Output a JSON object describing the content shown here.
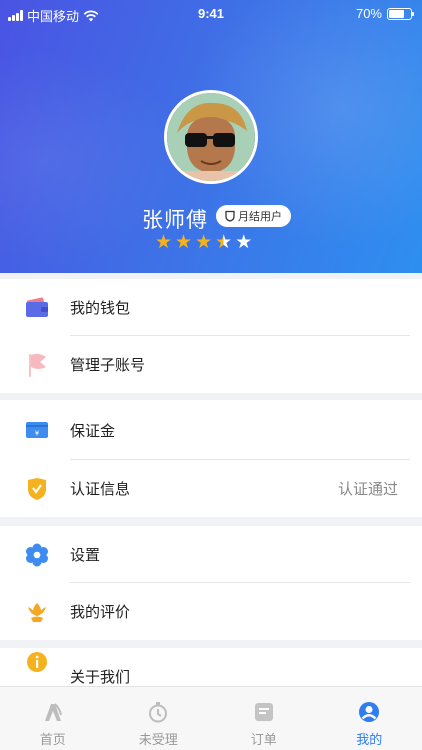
{
  "status_bar": {
    "carrier": "中国移动",
    "time": "9:41",
    "battery": "70%",
    "battery_level": 0.7
  },
  "profile": {
    "name": "张师傅",
    "badge": "月结用户",
    "rating": 3.5,
    "rating_max": 5
  },
  "menu": {
    "wallet": "我的钱包",
    "sub_accounts": "管理子账号",
    "deposit": "保证金",
    "verification": "认证信息",
    "verification_status": "认证通过",
    "settings": "设置",
    "reviews": "我的评价",
    "about": "关于我们"
  },
  "tabs": [
    {
      "label": "首页"
    },
    {
      "label": "未受理"
    },
    {
      "label": "订单"
    },
    {
      "label": "我的"
    }
  ],
  "colors": {
    "accent": "#2f7df0",
    "star": "#f5b21f",
    "header_start": "#4a54e3",
    "header_end": "#2e8ff0"
  }
}
